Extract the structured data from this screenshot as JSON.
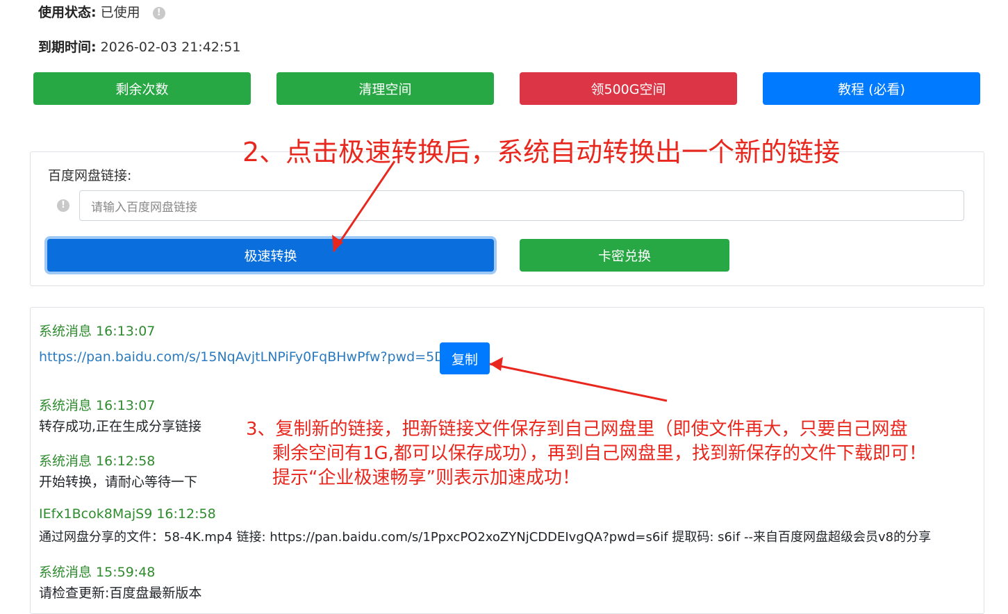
{
  "status": {
    "usage_label": "使用状态:",
    "usage_value": "已使用",
    "expiry_label": "到期时间:",
    "expiry_value": "2026-02-03 21:42:51"
  },
  "top_buttons": {
    "remaining": "剩余次数",
    "clean": "清理空间",
    "claim": "领500G空间",
    "tutorial": "教程 (必看)"
  },
  "form": {
    "label": "百度网盘链接:",
    "placeholder": "请输入百度网盘链接",
    "convert_button": "极速转换",
    "redeem_button": "卡密兑换"
  },
  "messages": [
    {
      "title": "系统消息 16:13:07",
      "link": "https://pan.baidu.com/s/15NqAvjtLNPiFy0FqBHwPfw?pwd=5DoS",
      "copy_label": "复制"
    },
    {
      "title": "系统消息 16:13:07",
      "body": "转存成功,正在生成分享链接"
    },
    {
      "title": "系统消息 16:12:58",
      "body": "开始转换，请耐心等待一下"
    },
    {
      "title": "IEfx1Bcok8MajS9 16:12:58",
      "body": "通过网盘分享的文件：58-4K.mp4 链接: https://pan.baidu.com/s/1PpxcPO2xoZYNjCDDEIvgQA?pwd=s6if 提取码: s6if --来自百度网盘超级会员v8的分享"
    },
    {
      "title": "系统消息 15:59:48",
      "body": "请检查更新:百度盘最新版本"
    }
  ],
  "annotations": {
    "step2": "2、点击极速转换后，系统自动转换出一个新的链接",
    "step3_line1": "3、复制新的链接，把新链接文件保存到自己网盘里（即使文件再大，只要自己网盘",
    "step3_line2": "剩余空间有1G,都可以保存成功），再到自己网盘里，找到新保存的文件下载即可！",
    "step3_line3": "提示“企业极速畅享”则表示加速成功！"
  },
  "colors": {
    "green": "#28a745",
    "red": "#dc3545",
    "blue": "#007bff",
    "annotation_red": "#e8281e",
    "message_title_green": "#2e8b2e"
  }
}
